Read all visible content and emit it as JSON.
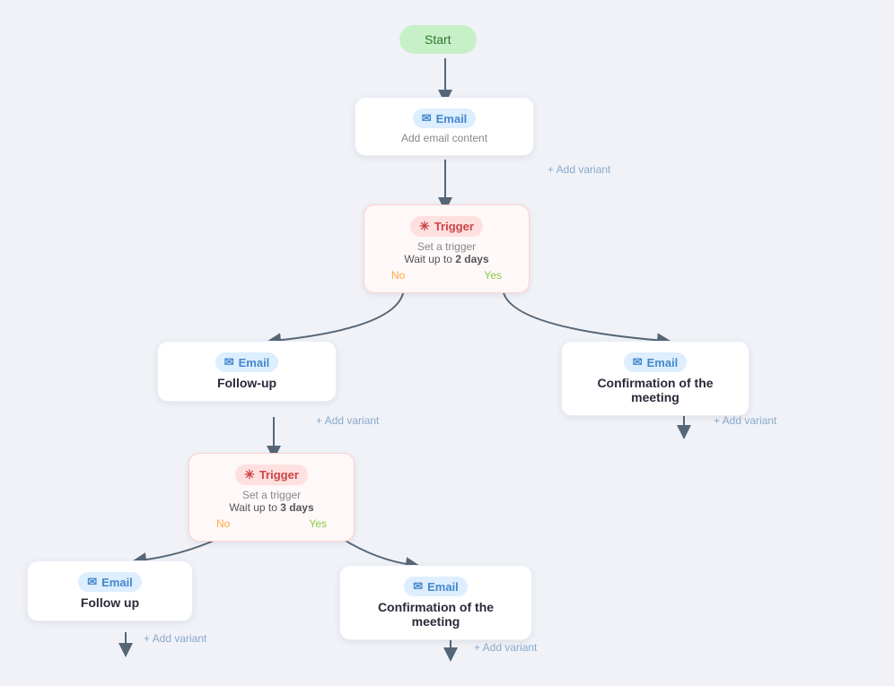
{
  "nodes": {
    "start": {
      "label": "Start"
    },
    "email1": {
      "badge": "Email",
      "title": "Add email content"
    },
    "trigger1": {
      "badge": "Trigger",
      "subtitle": "Set a trigger",
      "wait_prefix": "Wait up to",
      "wait_value": "2 days",
      "no": "No",
      "yes": "Yes"
    },
    "email_followup": {
      "badge": "Email",
      "title": "Follow-up"
    },
    "email_confirm1": {
      "badge": "Email",
      "title": "Confirmation of the meeting"
    },
    "trigger2": {
      "badge": "Trigger",
      "subtitle": "Set a trigger",
      "wait_prefix": "Wait up to",
      "wait_value": "3 days",
      "no": "No",
      "yes": "Yes"
    },
    "email_followup2": {
      "badge": "Email",
      "title": "Follow up"
    },
    "email_confirm2": {
      "badge": "Email",
      "title": "Confirmation of the meeting"
    }
  },
  "add_variant_label": "+ Add variant",
  "icons": {
    "email": "✉",
    "star": "✳"
  }
}
